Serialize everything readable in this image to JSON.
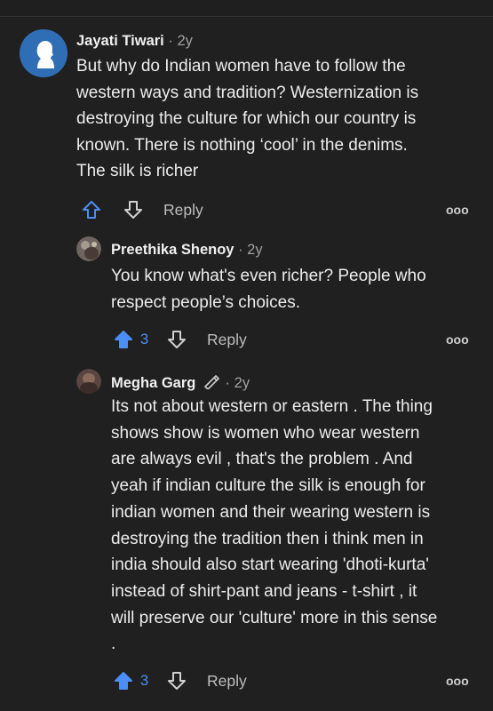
{
  "colors": {
    "background": "#202020",
    "upvote_active": "#4c8ef7",
    "text": "#ececec",
    "muted": "#a0a0a0"
  },
  "comments": [
    {
      "author": "Jayati Tiwari",
      "separator": "·",
      "time": "2y",
      "avatar_icon": "person-silhouette-icon",
      "text_lines": [
        "But why do Indian women have to follow the",
        "western ways and tradition? Westernization is",
        "destroying the culture for which our country is",
        "known. There is nothing ‘cool’ in the denims.",
        "The silk is richer"
      ],
      "upvotes": "",
      "reply_label": "Reply",
      "more_label": "ooo"
    },
    {
      "author": "Preethika Shenoy",
      "separator": "·",
      "time": "2y",
      "avatar_icon": "user-photo-icon",
      "text_lines": [
        "You know what's even richer? People who",
        "respect people’s choices."
      ],
      "upvotes": "3",
      "reply_label": "Reply",
      "more_label": "ooo"
    },
    {
      "author": "Megha Garg",
      "badge_icon": "pencil-badge-icon",
      "separator": "·",
      "time": "2y",
      "avatar_icon": "user-photo-icon",
      "text_lines": [
        "Its not about western or eastern . The thing",
        "shows show is women who wear western",
        "are always evil , that's the problem . And",
        "yeah if indian culture the silk is enough for",
        "indian women and their wearing western is",
        "destroying the tradition then i think men in",
        "india should also start wearing 'dhoti-kurta'",
        "instead of shirt-pant and jeans - t-shirt , it",
        "will preserve our 'culture' more in this sense",
        "."
      ],
      "upvotes": "3",
      "reply_label": "Reply",
      "more_label": "ooo"
    }
  ]
}
